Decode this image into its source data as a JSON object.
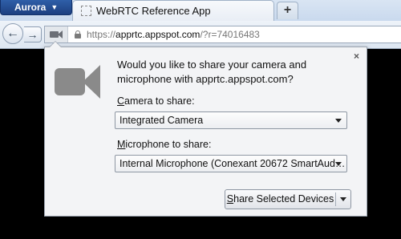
{
  "titlebar": {
    "app_button": "Aurora",
    "tab_title": "WebRTC Reference App",
    "new_tab": "+"
  },
  "navbar": {
    "back": "←",
    "forward": "→",
    "url_protocol": "https://",
    "url_host": "apprtc.appspot.com",
    "url_rest": "/?r=74016483"
  },
  "panel": {
    "close": "×",
    "question": "Would you like to share your camera and microphone with apprtc.appspot.com?",
    "camera_label_key": "C",
    "camera_label_rest": "amera to share:",
    "camera_selected": "Integrated Camera",
    "mic_label_key": "M",
    "mic_label_rest": "icrophone to share:",
    "mic_selected": "Internal Microphone (Conexant 20672 SmartAud…",
    "share_key": "S",
    "share_rest": "hare Selected Devices"
  },
  "icons": {
    "camera": "camera-icon",
    "lock": "lock-icon"
  }
}
